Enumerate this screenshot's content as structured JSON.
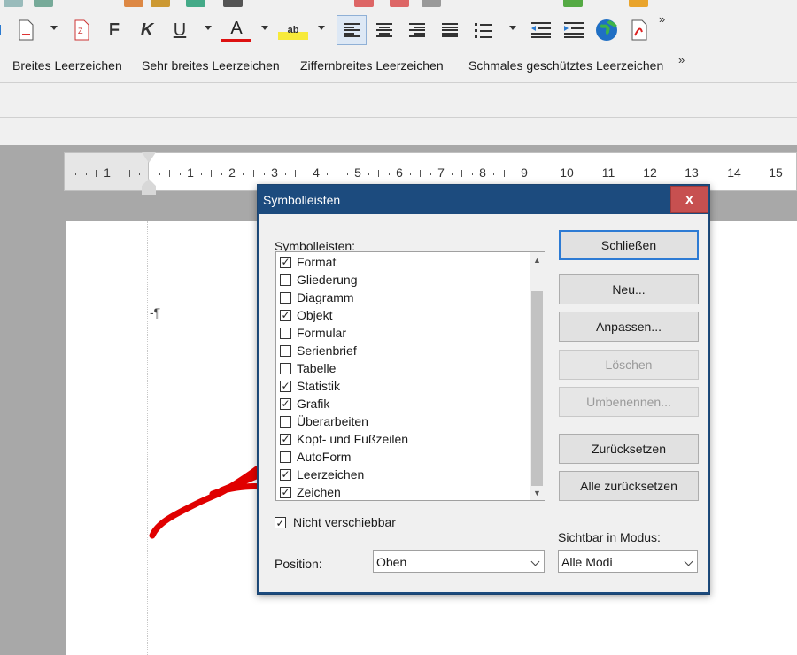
{
  "format_toolbar": {
    "bold": "F",
    "italic": "K",
    "underline": "U",
    "font_color": "A",
    "highlight": "ab",
    "more": "»"
  },
  "space_toolbar": {
    "items": [
      "Breites Leerzeichen",
      "Sehr breites Leerzeichen",
      "Ziffernbreites Leerzeichen",
      "Schmales geschütztes Leerzeichen"
    ],
    "more": "»"
  },
  "ruler": {
    "numbers": [
      "1",
      "1",
      "2",
      "3",
      "4",
      "5",
      "6",
      "7",
      "8",
      "9",
      "10",
      "11",
      "12",
      "13",
      "14",
      "15"
    ]
  },
  "document": {
    "pilcrow": "-¶"
  },
  "dialog": {
    "title": "Symbolleisten",
    "close_label": "x",
    "list_label": "Symbolleisten:",
    "toolbars": [
      {
        "label": "Format",
        "checked": true
      },
      {
        "label": "Gliederung",
        "checked": false
      },
      {
        "label": "Diagramm",
        "checked": false
      },
      {
        "label": "Objekt",
        "checked": true
      },
      {
        "label": "Formular",
        "checked": false
      },
      {
        "label": "Serienbrief",
        "checked": false
      },
      {
        "label": "Tabelle",
        "checked": false
      },
      {
        "label": "Statistik",
        "checked": true
      },
      {
        "label": "Grafik",
        "checked": true
      },
      {
        "label": "Überarbeiten",
        "checked": false
      },
      {
        "label": "Kopf- und Fußzeilen",
        "checked": true
      },
      {
        "label": "AutoForm",
        "checked": false
      },
      {
        "label": "Leerzeichen",
        "checked": true
      },
      {
        "label": "Zeichen",
        "checked": true
      }
    ],
    "buttons": {
      "close": "Schließen",
      "new": "Neu...",
      "customize": "Anpassen...",
      "delete": "Löschen",
      "rename": "Umbenennen...",
      "reset": "Zurücksetzen",
      "reset_all": "Alle zurücksetzen"
    },
    "not_movable": {
      "label": "Nicht verschiebbar",
      "checked": true
    },
    "position": {
      "label": "Position:",
      "value": "Oben"
    },
    "visible_mode": {
      "label": "Sichtbar in Modus:",
      "value": "Alle Modi"
    }
  },
  "colors": {
    "titlebar": "#1c4b7e",
    "close_button": "#c75050",
    "default_button_border": "#2d7bd4",
    "annotation_stroke": "#e00000"
  }
}
